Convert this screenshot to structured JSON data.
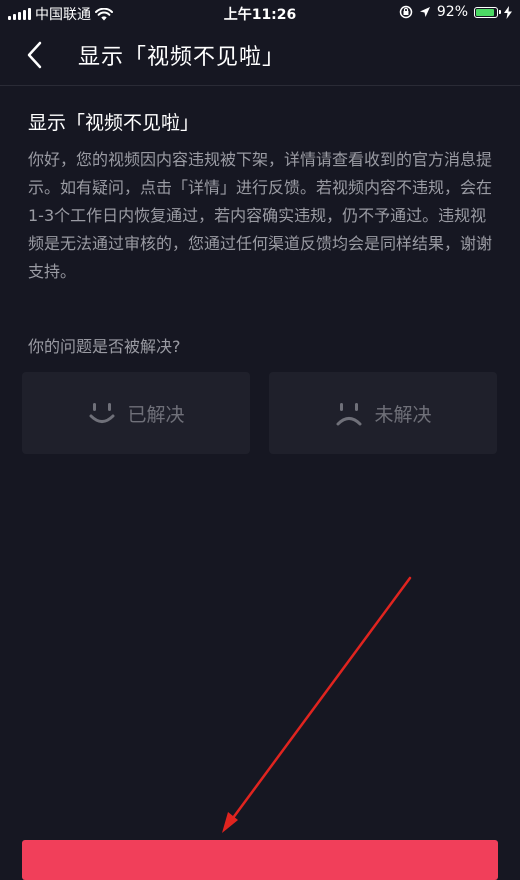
{
  "status_bar": {
    "carrier": "中国联通",
    "time": "上午11:26",
    "battery_percent": "92%",
    "battery_level": 0.92,
    "signal_icon": "signal-bars-icon",
    "wifi_icon": "wifi-icon",
    "lock_icon": "rotation-lock-icon",
    "location_icon": "location-arrow-icon",
    "charging_icon": "charging-bolt-icon"
  },
  "nav": {
    "back_icon": "chevron-left-icon",
    "title": "显示「视频不见啦」"
  },
  "content": {
    "title": "显示「视频不见啦」",
    "body": "你好，您的视频因内容违规被下架，详情请查看收到的官方消息提示。如有疑问，点击「详情」进行反馈。若视频内容不违规，会在1-3个工作日内恢复通过，若内容确实违规，仍不予通过。违规视频是无法通过审核的，您通过任何渠道反馈均会是同样结果，谢谢支持。"
  },
  "feedback": {
    "question": "你的问题是否被解决?",
    "resolved_label": "已解决",
    "resolved_icon": "smile-face-icon",
    "unresolved_label": "未解决",
    "unresolved_icon": "frown-face-icon"
  },
  "colors": {
    "background": "#161722",
    "accent": "#f13f5a",
    "arrow": "#e0241f",
    "muted_text": "#9a9ba3"
  }
}
